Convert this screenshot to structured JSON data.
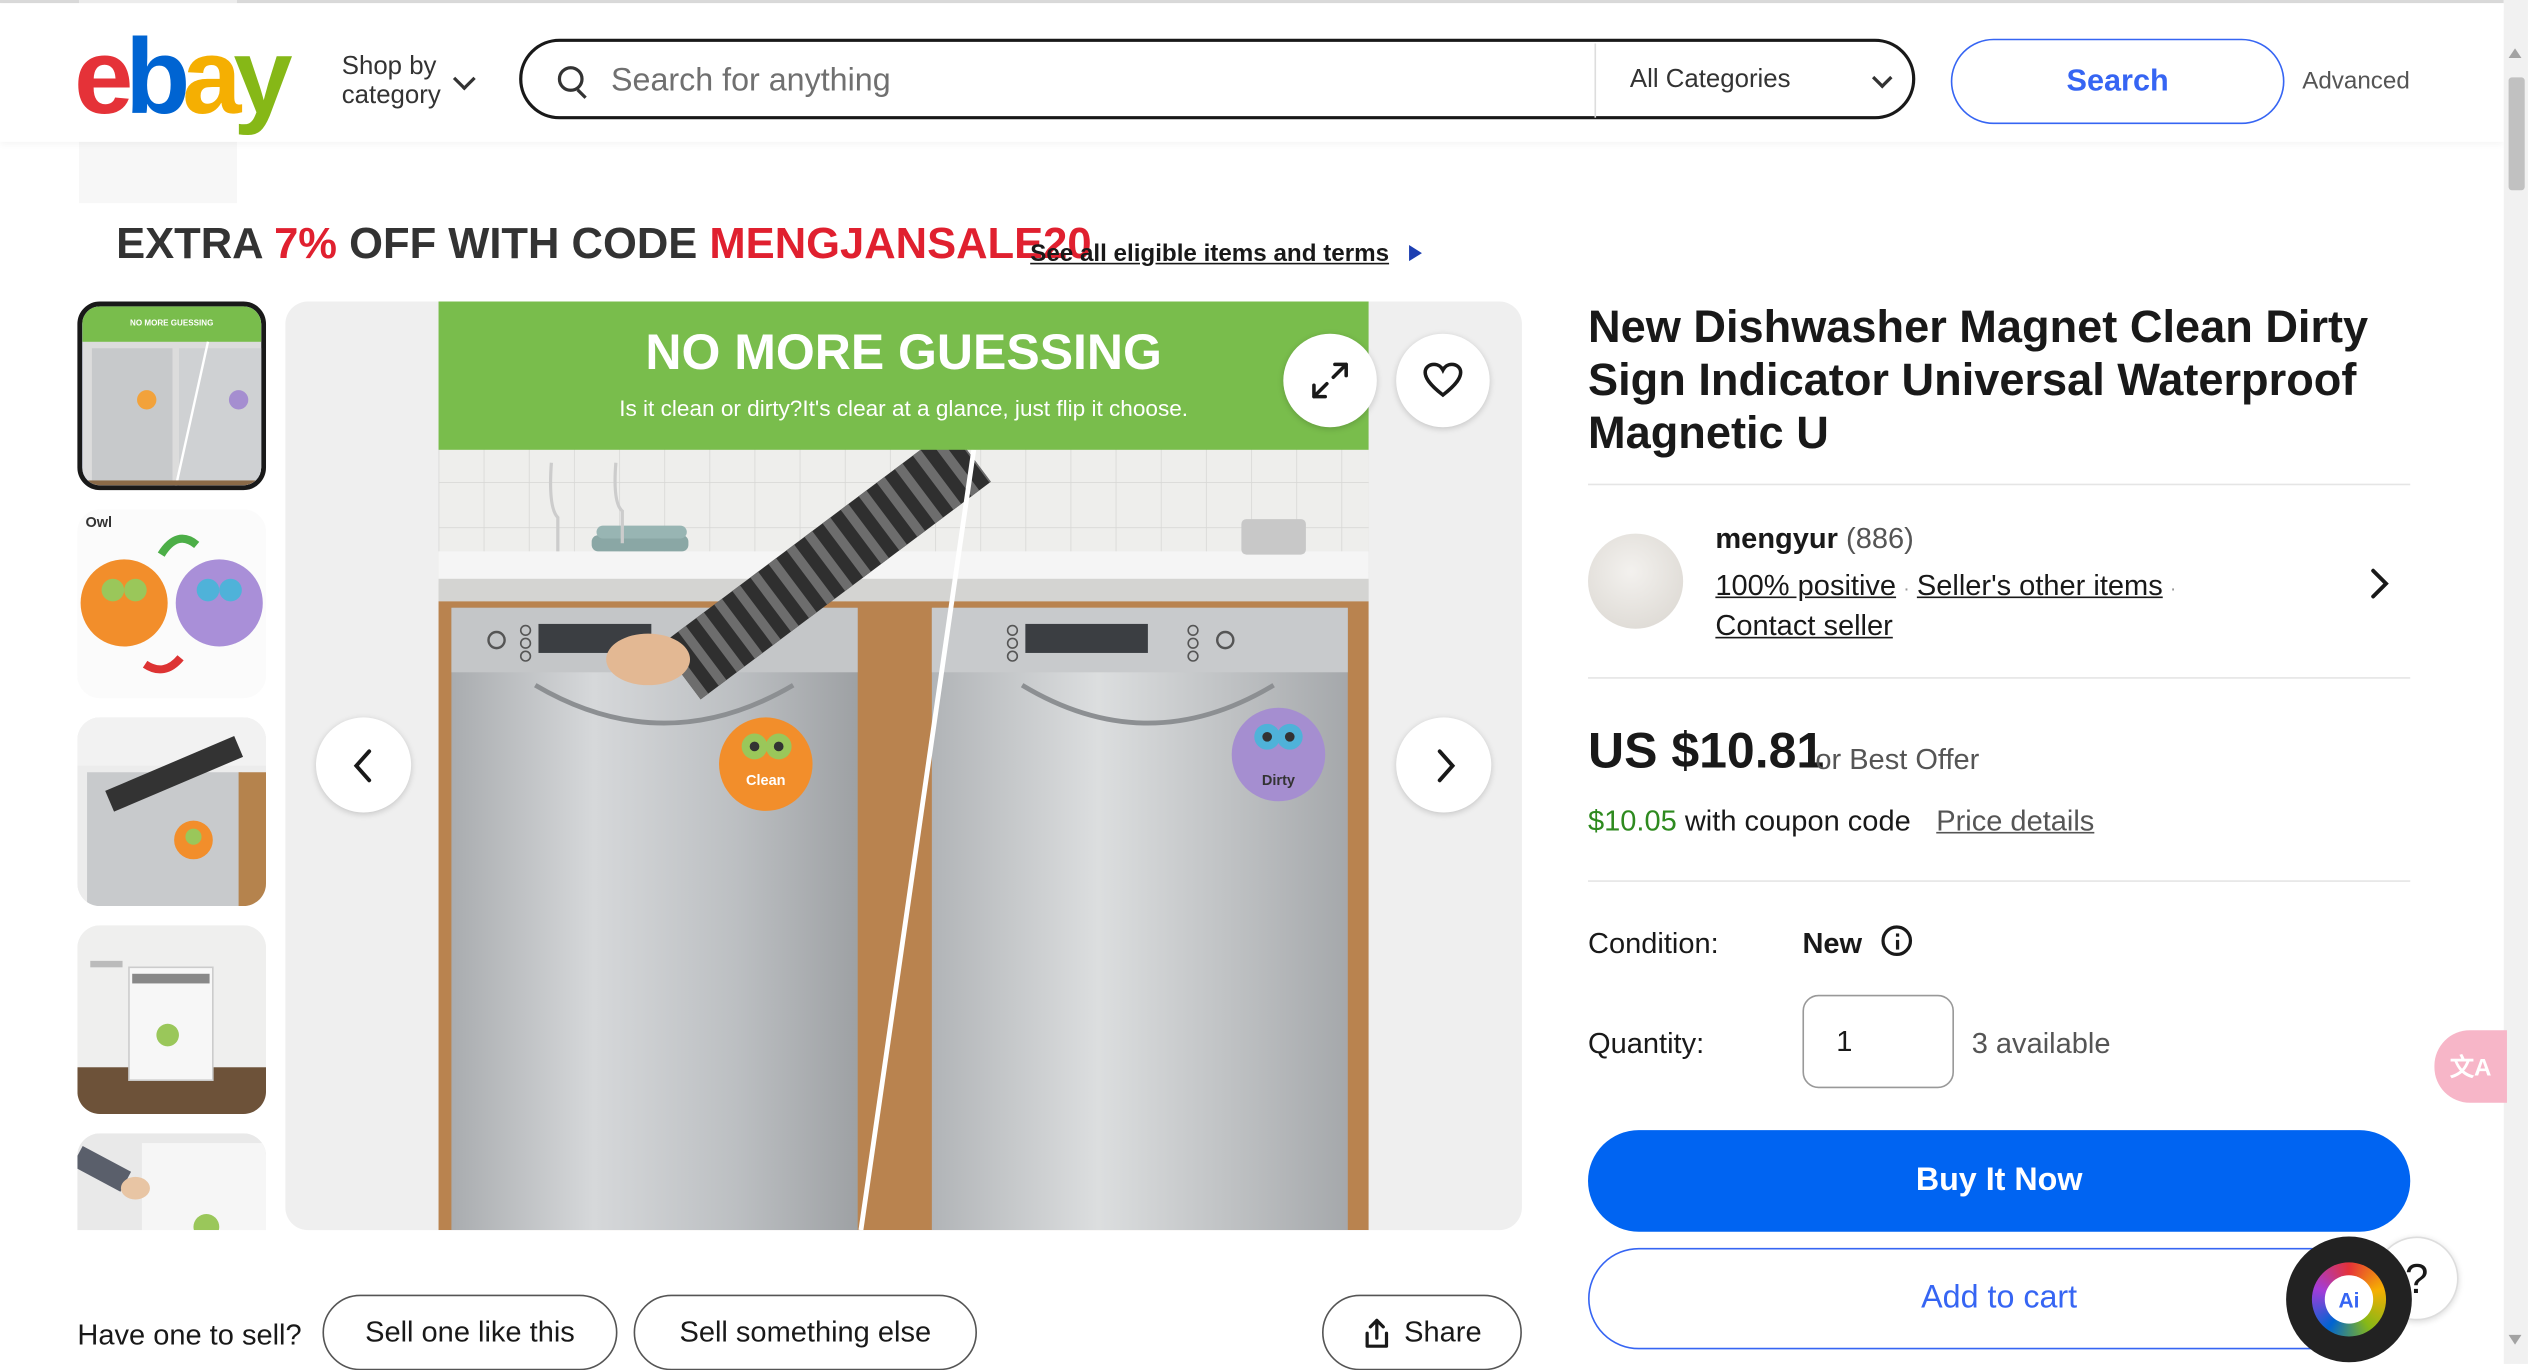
{
  "header": {
    "logo_letters": [
      "e",
      "b",
      "a",
      "y"
    ],
    "logo_colors": [
      "#e53238",
      "#0064d2",
      "#f5af02",
      "#86b817"
    ],
    "shop_by_line1": "Shop by",
    "shop_by_line2": "category",
    "search_placeholder": "Search for anything",
    "category_select": "All Categories",
    "search_button": "Search",
    "advanced_link": "Advanced"
  },
  "promo": {
    "prefix": "EXTRA ",
    "percent": "7%",
    "middle": " OFF WITH CODE ",
    "code": "MENGJANSALE20",
    "link": "See all eligible items and terms"
  },
  "gallery": {
    "image_banner_title": "NO MORE GUESSING",
    "image_banner_subtitle": "Is it clean or dirty?It's clear at a glance, just flip it choose.",
    "magnet_clean": "Clean",
    "magnet_dirty": "Dirty",
    "thumb2_label": "Owl",
    "thumb1_banner": "NO MORE GUESSING"
  },
  "listing": {
    "title": "New Dishwasher Magnet Clean Dirty Sign Indicator Universal Waterproof Magnetic U",
    "seller_name": "mengyur",
    "seller_count": "(886)",
    "feedback": "100% positive",
    "other_items": "Seller's other items",
    "contact": "Contact seller",
    "price": "US $10.81",
    "best_offer": "or Best Offer",
    "coupon_price": "$10.05",
    "coupon_text": " with coupon code",
    "price_details": "Price details",
    "condition_label": "Condition:",
    "condition_value": "New",
    "quantity_label": "Quantity:",
    "quantity_value": "1",
    "available": "3 available",
    "buy_now": "Buy It Now",
    "add_to_cart": "Add to cart"
  },
  "bottom": {
    "have_one": "Have one to sell?",
    "sell_like": "Sell one like this",
    "sell_else": "Sell something else",
    "share": "Share"
  },
  "floating": {
    "ai_label": "Ai",
    "help": "?",
    "translate_glyph": "文A"
  },
  "colors": {
    "accent_blue": "#3665f3",
    "buy_blue": "#0064f2",
    "promo_red": "#e0202f",
    "coupon_green": "#2e8a1f",
    "banner_green": "#79bd4c"
  }
}
